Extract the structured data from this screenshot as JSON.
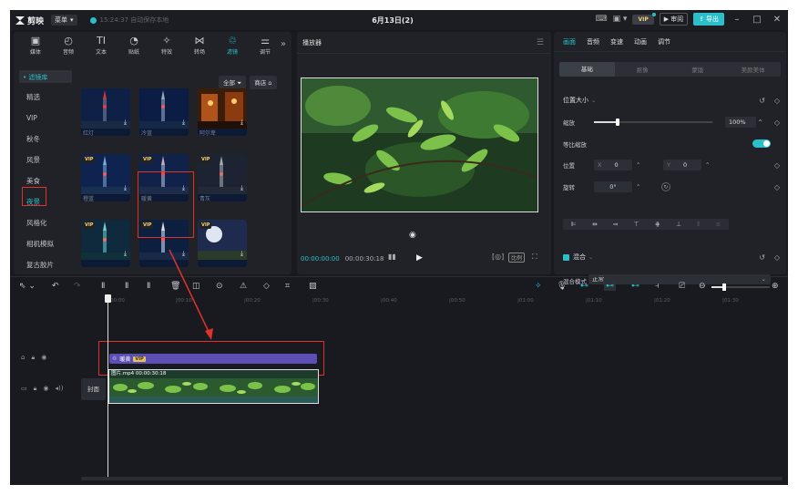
{
  "titlebar": {
    "app_name": "剪映",
    "menu_label": "菜单",
    "save_status": "15:24:37 自动保存本地",
    "project_title": "6月13日(2)",
    "vip_label": "VIP",
    "review_label": "审阅",
    "export_label": "导出"
  },
  "media_tools": [
    {
      "label": "媒体",
      "icon": "media-icon"
    },
    {
      "label": "音频",
      "icon": "audio-icon"
    },
    {
      "label": "文本",
      "icon": "text-icon"
    },
    {
      "label": "贴纸",
      "icon": "sticker-icon"
    },
    {
      "label": "特效",
      "icon": "effects-icon"
    },
    {
      "label": "转场",
      "icon": "transition-icon"
    },
    {
      "label": "滤镜",
      "icon": "filter-icon"
    },
    {
      "label": "调节",
      "icon": "adjust-icon"
    }
  ],
  "filter_panel": {
    "library_label": "• 滤镜库",
    "categories": [
      "精选",
      "VIP",
      "秋冬",
      "风景",
      "美食",
      "夜景",
      "风格化",
      "相机模拟",
      "复古胶片"
    ],
    "selected_category": "夜景",
    "all_label": "全部",
    "store_label": "商店",
    "thumbnails": [
      {
        "name": "红灯",
        "vip": false
      },
      {
        "name": "冷蓝",
        "vip": false
      },
      {
        "name": "阿尔卑",
        "vip": false
      },
      {
        "name": "橙蓝",
        "vip": true
      },
      {
        "name": "暖黄",
        "vip": true
      },
      {
        "name": "青灰",
        "vip": true
      },
      {
        "name": "",
        "vip": true
      },
      {
        "name": "",
        "vip": true
      },
      {
        "name": "",
        "vip": true
      }
    ],
    "vip_tag": "VIP"
  },
  "player": {
    "title": "播放器",
    "current_time": "00:00:00:00",
    "total_time": "00:00:30:18",
    "ratio_label": "比例"
  },
  "properties": {
    "tabs": [
      "画面",
      "音频",
      "变速",
      "动画",
      "调节"
    ],
    "active_tab": "画面",
    "subtabs": [
      "基础",
      "抠像",
      "蒙版",
      "美颜美体"
    ],
    "active_subtab": "基础",
    "section_position": "位置大小",
    "scale_label": "缩放",
    "scale_value": "100%",
    "uniform_scale_label": "等比缩放",
    "position_label": "位置",
    "pos_x_label": "X",
    "pos_x": "0",
    "pos_y_label": "Y",
    "pos_y": "0",
    "rotation_label": "旋转",
    "rotation": "0°",
    "section_blend": "混合",
    "blend_mode_label": "混合模式",
    "blend_mode_value": "正常"
  },
  "timeline": {
    "ruler": [
      "00:00",
      "|00:10",
      "|00:20",
      "|00:30",
      "|00:40",
      "|00:50",
      "|01:00",
      "|01:10",
      "|01:20",
      "|01:30"
    ],
    "filter_clip_label": "暖黄",
    "filter_clip_vip": "VIP",
    "video_clip_label": "图片.mp4  00:00:30:18",
    "cover_label": "封面"
  },
  "colors": {
    "accent": "#2bc0c9",
    "highlight_box": "#e0312a",
    "filter_clip": "#5b4fb5"
  }
}
